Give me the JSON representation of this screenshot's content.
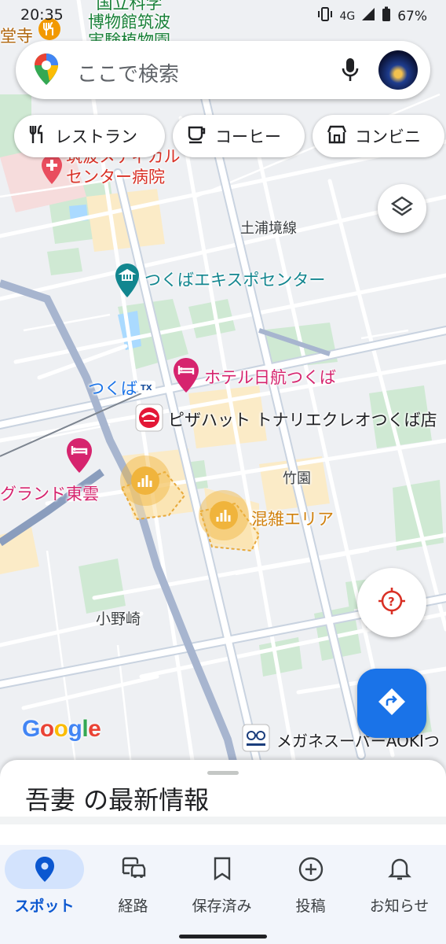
{
  "status": {
    "time": "20:35",
    "network": "4G",
    "battery": "67%"
  },
  "search": {
    "placeholder": "ここで検索"
  },
  "chips": [
    {
      "label": "レストラン",
      "icon": "restaurant-icon"
    },
    {
      "label": "コーヒー",
      "icon": "coffee-icon"
    },
    {
      "label": "コンビニ",
      "icon": "convenience-store-icon"
    }
  ],
  "map": {
    "labels": {
      "museum": "国立科学\n博物館筑波\n実験植物園",
      "temple": "堂寺",
      "hospital": "筑波メディカル\nセンター病院",
      "road": "土浦境線",
      "expo_center": "つくばエキスポセンター",
      "hotel_nikko": "ホテル日航つくば",
      "tsukuba_station": "つくば",
      "pizza_hut": "ピザハット トナリエクレオつくば店",
      "takezono": "竹園",
      "grand_toun": "グランド東雲",
      "crowded_area": "混雑エリア",
      "onozaki": "小野崎",
      "megane": "メガネスーパーAOKIつ"
    },
    "logo": "Google"
  },
  "sheet": {
    "title": "吾妻 の最新情報"
  },
  "nav": [
    {
      "label": "スポット",
      "icon": "place-icon",
      "active": true
    },
    {
      "label": "経路",
      "icon": "commute-icon",
      "active": false
    },
    {
      "label": "保存済み",
      "icon": "bookmark-icon",
      "active": false
    },
    {
      "label": "投稿",
      "icon": "add-circle-icon",
      "active": false
    },
    {
      "label": "お知らせ",
      "icon": "bell-icon",
      "active": false
    }
  ],
  "colors": {
    "accent": "#1a73e8",
    "nav_active_pill": "#d3e3fd",
    "crowd_marker": "#f0b43c",
    "poi_pink": "#d6246e",
    "poi_teal": "#12868f"
  }
}
